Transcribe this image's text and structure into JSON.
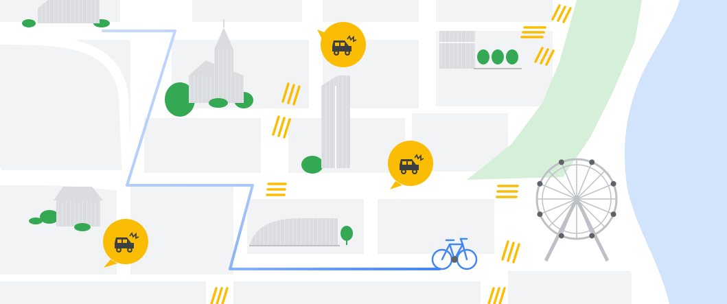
{
  "map": {
    "colors": {
      "background": "#ffffff",
      "block": "#f1f3f4",
      "building": "#dadce0",
      "building_line": "#ffffff",
      "park": "#d6efd9",
      "water": "#d2e3fc",
      "tree": "#34a853",
      "crosswalk": "#fbbc04",
      "route": "#4285f4",
      "route_faded": "#c6dafc",
      "marker": "#fbbc04",
      "marker_icon": "#3c4043",
      "bicycle": "#4285f4",
      "bicycle_dark": "#3c4043",
      "ferris_wheel": "#bdc1c6",
      "ferris_cab": "#5f6368"
    },
    "markers": [
      {
        "name": "car-crash-incident-marker-north",
        "icon": "car-crash-icon"
      },
      {
        "name": "car-crash-incident-marker-center",
        "icon": "car-crash-icon"
      },
      {
        "name": "car-crash-incident-marker-southwest",
        "icon": "car-crash-icon"
      }
    ],
    "landmarks": [
      "church",
      "office-tower",
      "house",
      "warehouse",
      "small-building",
      "ferris-wheel"
    ],
    "route_mode": "bicycle-icon"
  }
}
